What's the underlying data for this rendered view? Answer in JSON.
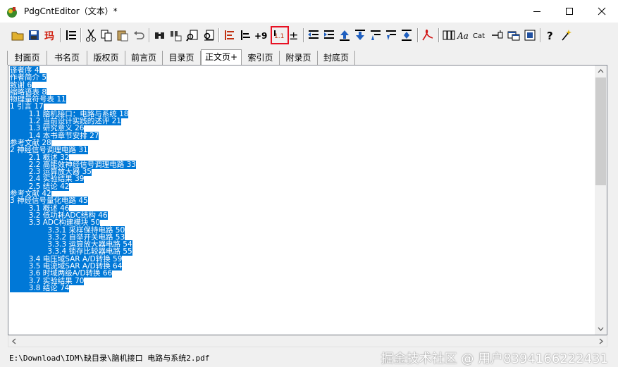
{
  "window": {
    "title": "PdgCntEditor（文本）*",
    "controls": [
      "minimize-icon",
      "maximize-icon",
      "close-icon"
    ]
  },
  "toolbar": {
    "buttons": [
      {
        "name": "open-icon"
      },
      {
        "name": "save-icon"
      },
      {
        "name": "chinese-ma-icon",
        "glyph": "玛"
      },
      {
        "name": "indent-list-icon"
      },
      {
        "name": "cut-icon"
      },
      {
        "name": "copy-icon"
      },
      {
        "name": "paste-icon"
      },
      {
        "name": "undo-icon"
      },
      {
        "name": "find-icon"
      },
      {
        "name": "find-replace-icon"
      },
      {
        "name": "find-page-icon"
      },
      {
        "name": "find-next-page-icon"
      },
      {
        "name": "align-left-icon"
      },
      {
        "name": "align-right-icon"
      },
      {
        "name": "add-number-icon",
        "glyph": "+9"
      },
      {
        "name": "page-number-icon",
        "glyph": "1.1"
      },
      {
        "name": "plus-minus-icon",
        "glyph": "±"
      },
      {
        "name": "outdent-icon"
      },
      {
        "name": "indent-icon"
      },
      {
        "name": "move-up-icon"
      },
      {
        "name": "move-down-icon"
      },
      {
        "name": "level-up-icon"
      },
      {
        "name": "level-down-icon"
      },
      {
        "name": "expand-icon"
      },
      {
        "name": "pdf-icon"
      },
      {
        "name": "columns-icon"
      },
      {
        "name": "font-icon",
        "glyph": "Aa"
      },
      {
        "name": "cat-icon",
        "glyph": "Cat"
      },
      {
        "name": "link-icon"
      },
      {
        "name": "window-icon"
      },
      {
        "name": "export-icon"
      },
      {
        "name": "help-icon",
        "glyph": "?"
      },
      {
        "name": "magic-icon"
      }
    ],
    "selected": "page-number-icon"
  },
  "tabs": [
    "封面页",
    "书名页",
    "版权页",
    "前言页",
    "目录页",
    "正文页+",
    "索引页",
    "附录页",
    "封底页"
  ],
  "active_tab": "正文页+",
  "content_lines": [
    "译者序 4",
    "作者简介 5",
    "致谢 6",
    "缩略语表 8",
    "物理量符号表 11",
    "1 引言 17",
    "        1.1 脑机接口：电路与系统 18",
    "        1.2 当前设计实践的述评 21",
    "        1.3 研究意义 26",
    "        1.4 本书章节安排 27",
    "参考文献 28",
    "2 神经信号调理电路 31",
    "        2.1 概述 32",
    "        2.2 高能效神经信号调理电路 33",
    "        2.3 运算放大器 35",
    "        2.4 实验结果 39",
    "        2.5 结论 42",
    "参考文献 42",
    "3 神经信号量化电路 45",
    "        3.1 概述 46",
    "        3.2 低功耗ADC结构 46",
    "        3.3 ADC构建模块 50",
    "                3.3.1 采样保持电路 50",
    "                3.3.2 自举开关电路 53",
    "                3.3.3 运算放大器电路 54",
    "                3.3.4 锁存比较器电路 55",
    "        3.4 电压域SAR A/D转换 59",
    "        3.5 电流域SAR A/D转换 64",
    "        3.6 时域两级A/D转换 66",
    "        3.7 实验结果 70",
    "        3.8 结论 74"
  ],
  "status": {
    "path": "E:\\Download\\IDM\\缺目录\\脑机接口 电路与系统2.pdf",
    "watermark": "掘金技术社区 @ 用户8394166222431"
  }
}
